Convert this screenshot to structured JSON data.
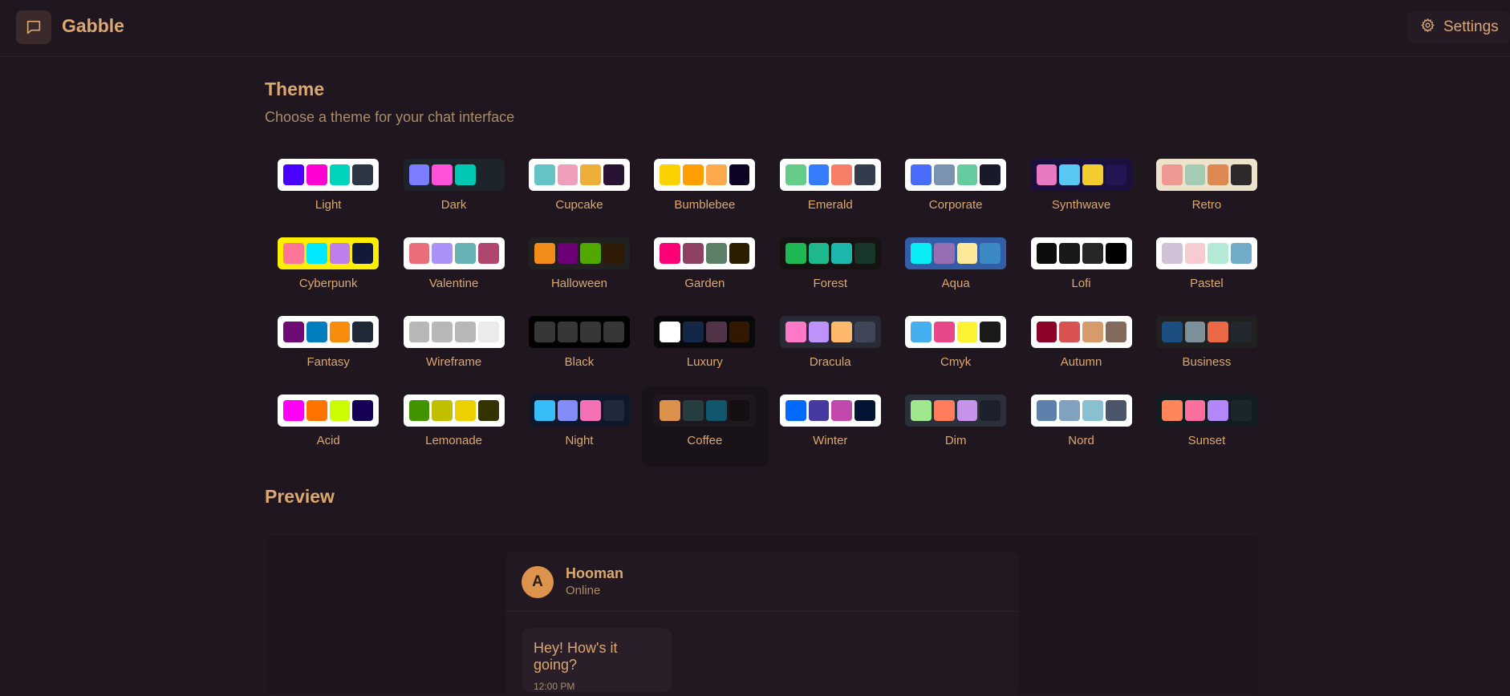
{
  "app": {
    "title": "Gabble"
  },
  "header": {
    "settings_label": "Settings"
  },
  "theme_section": {
    "title": "Theme",
    "subtitle": "Choose a theme for your chat interface"
  },
  "themes": [
    {
      "name": "Light",
      "frame": "#ffffff",
      "colors": [
        "#4a00ff",
        "#ff00d3",
        "#00d3bb",
        "#2c3644"
      ]
    },
    {
      "name": "Dark",
      "frame": "#1d232a",
      "colors": [
        "#7c7cff",
        "#ff52d9",
        "#00c8b2",
        "#1d232a"
      ]
    },
    {
      "name": "Cupcake",
      "frame": "#ffffff",
      "colors": [
        "#65c3c8",
        "#ef9fbc",
        "#eeaf3a",
        "#291334"
      ]
    },
    {
      "name": "Bumblebee",
      "frame": "#ffffff",
      "colors": [
        "#fbd100",
        "#ff9e00",
        "#ffa94d",
        "#0d0323"
      ]
    },
    {
      "name": "Emerald",
      "frame": "#ffffff",
      "colors": [
        "#66cc8a",
        "#377cfb",
        "#f68067",
        "#333c4d"
      ]
    },
    {
      "name": "Corporate",
      "frame": "#ffffff",
      "colors": [
        "#4b6bfb",
        "#7b92b2",
        "#67cba0",
        "#181a2a"
      ]
    },
    {
      "name": "Synthwave",
      "frame": "#1a103d",
      "colors": [
        "#e779c1",
        "#58c7f3",
        "#f3cc30",
        "#221551"
      ]
    },
    {
      "name": "Retro",
      "frame": "#ece3ca",
      "colors": [
        "#ef9995",
        "#a4cbb4",
        "#dc8850",
        "#2e282a"
      ]
    },
    {
      "name": "Cyberpunk",
      "frame": "#ffee00",
      "colors": [
        "#ff7598",
        "#00e8ff",
        "#c07eec",
        "#111a3b"
      ]
    },
    {
      "name": "Valentine",
      "frame": "#ffffff",
      "colors": [
        "#e96d7b",
        "#a991f7",
        "#66b1b3",
        "#af4670"
      ]
    },
    {
      "name": "Halloween",
      "frame": "#212121",
      "colors": [
        "#f28c18",
        "#6d0076",
        "#51a800",
        "#2f1b05"
      ]
    },
    {
      "name": "Garden",
      "frame": "#ffffff",
      "colors": [
        "#fe0075",
        "#8e4162",
        "#5c7f67",
        "#291e00"
      ]
    },
    {
      "name": "Forest",
      "frame": "#171212",
      "colors": [
        "#1eb854",
        "#1db88e",
        "#1db8ab",
        "#19362d"
      ]
    },
    {
      "name": "Aqua",
      "frame": "#345da7",
      "colors": [
        "#09ecf3",
        "#966fb3",
        "#ffe999",
        "#3b8ac4"
      ]
    },
    {
      "name": "Lofi",
      "frame": "#ffffff",
      "colors": [
        "#0d0d0d",
        "#1a1919",
        "#262626",
        "#000000"
      ]
    },
    {
      "name": "Pastel",
      "frame": "#ffffff",
      "colors": [
        "#d1c1d7",
        "#f6cbd1",
        "#b4e9d6",
        "#70acc7"
      ]
    },
    {
      "name": "Fantasy",
      "frame": "#ffffff",
      "colors": [
        "#6e0b75",
        "#007ebd",
        "#f88c0d",
        "#1f2937"
      ]
    },
    {
      "name": "Wireframe",
      "frame": "#ffffff",
      "colors": [
        "#b8b8b8",
        "#b8b8b8",
        "#b8b8b8",
        "#ebebeb"
      ]
    },
    {
      "name": "Black",
      "frame": "#000000",
      "colors": [
        "#373737",
        "#373737",
        "#373737",
        "#373737"
      ]
    },
    {
      "name": "Luxury",
      "frame": "#09090b",
      "colors": [
        "#ffffff",
        "#152747",
        "#513448",
        "#331800"
      ]
    },
    {
      "name": "Dracula",
      "frame": "#282a36",
      "colors": [
        "#ff79c6",
        "#bd93f9",
        "#ffb86c",
        "#414558"
      ]
    },
    {
      "name": "Cmyk",
      "frame": "#ffffff",
      "colors": [
        "#45aeee",
        "#e8488a",
        "#fff232",
        "#1a1a1a"
      ]
    },
    {
      "name": "Autumn",
      "frame": "#ffffff",
      "colors": [
        "#8c0327",
        "#d85251",
        "#d59b6a",
        "#826a5c"
      ]
    },
    {
      "name": "Business",
      "frame": "#202020",
      "colors": [
        "#1c4e80",
        "#7c909a",
        "#ea6947",
        "#23282e"
      ]
    },
    {
      "name": "Acid",
      "frame": "#ffffff",
      "colors": [
        "#ff00f4",
        "#ff7400",
        "#cbfd03",
        "#140055"
      ]
    },
    {
      "name": "Lemonade",
      "frame": "#ffffff",
      "colors": [
        "#419400",
        "#bfbf00",
        "#edd000",
        "#343300"
      ]
    },
    {
      "name": "Night",
      "frame": "#0f172a",
      "colors": [
        "#38bdf8",
        "#818cf8",
        "#f471b5",
        "#1e293b"
      ]
    },
    {
      "name": "Coffee",
      "frame": "#20161f",
      "colors": [
        "#db924b",
        "#263e3f",
        "#10576d",
        "#140f13"
      ],
      "selected": true
    },
    {
      "name": "Winter",
      "frame": "#ffffff",
      "colors": [
        "#0069ff",
        "#463aa1",
        "#c148ac",
        "#021431"
      ]
    },
    {
      "name": "Dim",
      "frame": "#2a303c",
      "colors": [
        "#9fe88d",
        "#ff7d5c",
        "#c792e9",
        "#1c212b"
      ]
    },
    {
      "name": "Nord",
      "frame": "#ffffff",
      "colors": [
        "#5e81ac",
        "#81a1c1",
        "#88c0d0",
        "#4c566a"
      ]
    },
    {
      "name": "Sunset",
      "frame": "#121c22",
      "colors": [
        "#ff865b",
        "#fd6f9c",
        "#b387fa",
        "#1b262c"
      ]
    }
  ],
  "preview_section": {
    "title": "Preview"
  },
  "chat": {
    "avatar_letter": "A",
    "contact_name": "Hooman",
    "status": "Online",
    "message_text": "Hey! How's it going?",
    "message_time": "12:00 PM"
  }
}
